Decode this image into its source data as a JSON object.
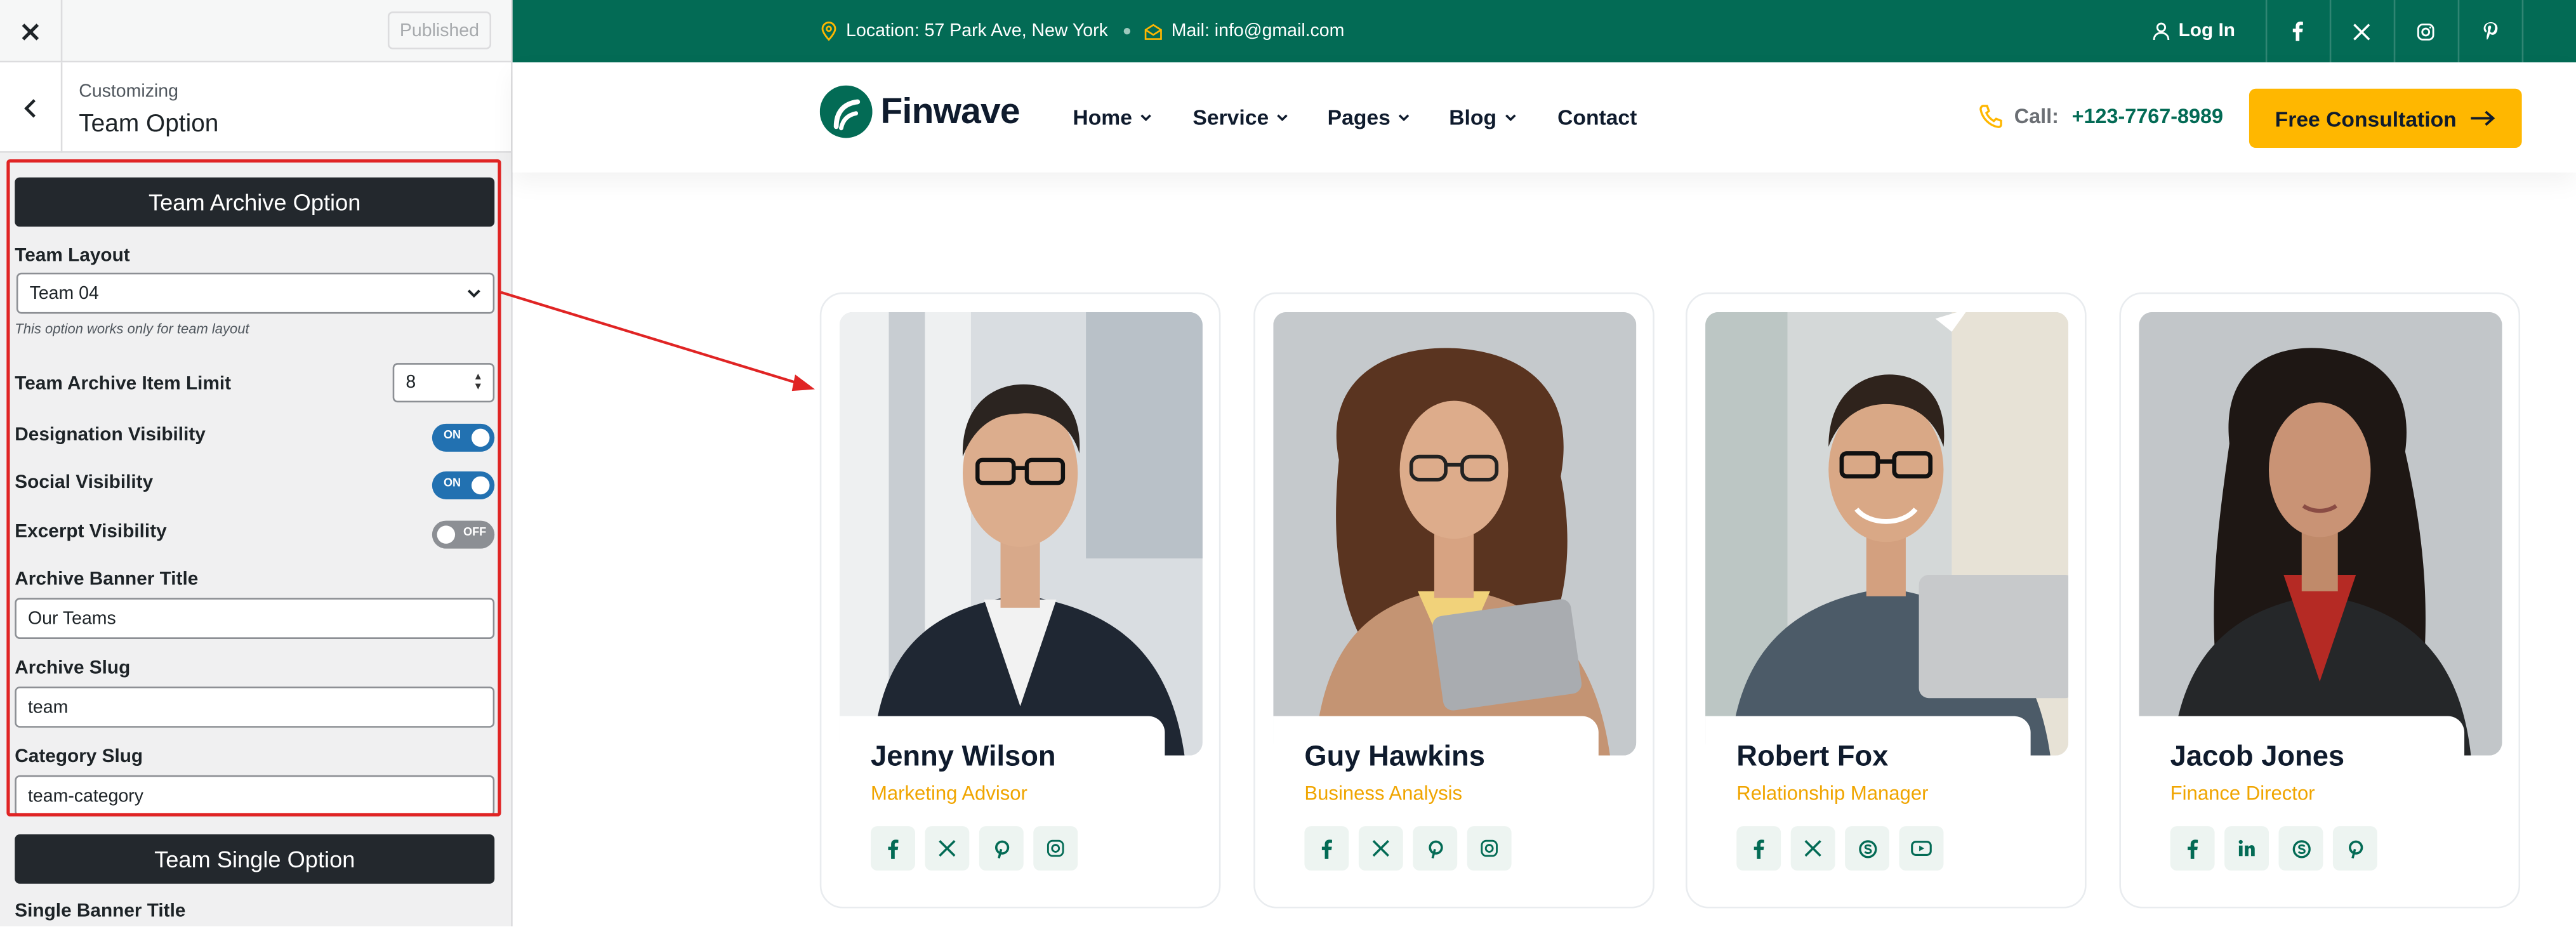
{
  "customizer": {
    "published_label": "Published",
    "breadcrumb": "Customizing",
    "section_title": "Team Option",
    "archive_header": "Team Archive Option",
    "team_layout_label": "Team Layout",
    "team_layout_value": "Team 04",
    "team_layout_note": "This option works only for team layout",
    "item_limit_label": "Team Archive Item Limit",
    "item_limit_value": "8",
    "designation_label": "Designation Visibility",
    "designation_state": "ON",
    "social_label": "Social Visibility",
    "social_state": "ON",
    "excerpt_label": "Excerpt Visibility",
    "excerpt_state": "OFF",
    "banner_title_label": "Archive Banner Title",
    "banner_title_value": "Our Teams",
    "archive_slug_label": "Archive Slug",
    "archive_slug_value": "team",
    "category_slug_label": "Category Slug",
    "category_slug_value": "team-category",
    "single_header": "Team Single Option",
    "single_banner_label": "Single Banner Title"
  },
  "topbar": {
    "location": "Location: 57 Park Ave, New York",
    "mail": "Mail: info@gmail.com",
    "login": "Log In",
    "social_icons": [
      "facebook-icon",
      "x-icon",
      "instagram-icon",
      "pinterest-icon"
    ]
  },
  "nav": {
    "brand": "Finwave",
    "items": [
      "Home",
      "Service",
      "Pages",
      "Blog",
      "Contact"
    ],
    "call_label": "Call:",
    "call_number": "+123-7767-8989",
    "cta": "Free Consultation"
  },
  "team": [
    {
      "name": "Jenny Wilson",
      "role": "Marketing Advisor",
      "socials": [
        "facebook",
        "x",
        "pinterest",
        "instagram"
      ]
    },
    {
      "name": "Guy Hawkins",
      "role": "Business Analysis",
      "socials": [
        "facebook",
        "x",
        "pinterest",
        "instagram"
      ]
    },
    {
      "name": "Robert Fox",
      "role": "Relationship Manager",
      "socials": [
        "facebook",
        "x",
        "skype",
        "youtube"
      ]
    },
    {
      "name": "Jacob Jones",
      "role": "Finance Director",
      "socials": [
        "facebook",
        "linkedin",
        "skype",
        "pinterest"
      ]
    }
  ],
  "colors": {
    "brand_green": "#036b55",
    "accent_yellow": "#ffb700",
    "role_orange": "#f0a500",
    "toggle_blue": "#2271b1",
    "annotation_red": "#e02424"
  }
}
